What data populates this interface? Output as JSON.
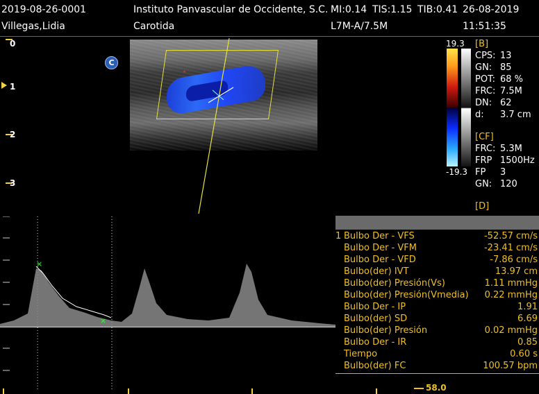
{
  "header": {
    "patient_id": "2019-08-26-0001",
    "patient_name": "Villegas,Lidia",
    "institution": "Instituto Panvascular de Occidente, S.C.",
    "mi": "MI:0.14",
    "tis": "TIS:1.15",
    "tib": "TIB:0.41",
    "date": "26-08-2019",
    "exam": "Carotida",
    "probe": "L7M-A/7.5M",
    "time": "11:51:35"
  },
  "depth_scale": [
    "0",
    "1",
    "2",
    "3"
  ],
  "mode_badge": "C",
  "color_scale": {
    "max": "19.3",
    "min": "-19.3"
  },
  "b_params": {
    "section": "[B]",
    "rows": [
      {
        "k": "CPS:",
        "v": "13"
      },
      {
        "k": "GN:",
        "v": "85"
      },
      {
        "k": "POT:",
        "v": "68 %"
      },
      {
        "k": "FRC:",
        "v": "7.5M"
      },
      {
        "k": "DN:",
        "v": "62"
      },
      {
        "k": "d:",
        "v": "3.7 cm"
      }
    ]
  },
  "cf_params": {
    "section": "[CF]",
    "rows": [
      {
        "k": "FRC:",
        "v": "5.3M"
      },
      {
        "k": "FRP",
        "v": "1500Hz"
      },
      {
        "k": "FP",
        "v": "3"
      },
      {
        "k": "GN:",
        "v": "120"
      }
    ]
  },
  "d_params": {
    "section": "[D]"
  },
  "measurements": {
    "index": "1",
    "rows": [
      {
        "label": "Bulbo Der - VFS",
        "value": "-52.57 cm/s"
      },
      {
        "label": "Bulbo Der - VFM",
        "value": "-23.41 cm/s"
      },
      {
        "label": "Bulbo Der - VFD",
        "value": "-7.86 cm/s"
      },
      {
        "label": "Bulbo(der) IVT",
        "value": "13.97 cm"
      },
      {
        "label": "Bulbo(der) Presión(Vs)",
        "value": "1.11 mmHg"
      },
      {
        "label": "Bulbo(der) Presión(Vmedia)",
        "value": "0.22 mmHg"
      },
      {
        "label": "Bulbo Der - IP",
        "value": "1.91"
      },
      {
        "label": "Bulbo(der) SD",
        "value": "6.69"
      },
      {
        "label": "Bulbo(der) Presión",
        "value": "0.02 mmHg"
      },
      {
        "label": "Bulbo Der - IR",
        "value": "0.85"
      },
      {
        "label": "Tiempo",
        "value": "0.60 s"
      },
      {
        "label": "Bulbo(der) FC",
        "value": "100.57 bpm"
      }
    ]
  },
  "sweep_speed": "58.0",
  "colors": {
    "accent": "#f0c020",
    "roi": "#e8e23a",
    "flow": "#2a6bff"
  }
}
